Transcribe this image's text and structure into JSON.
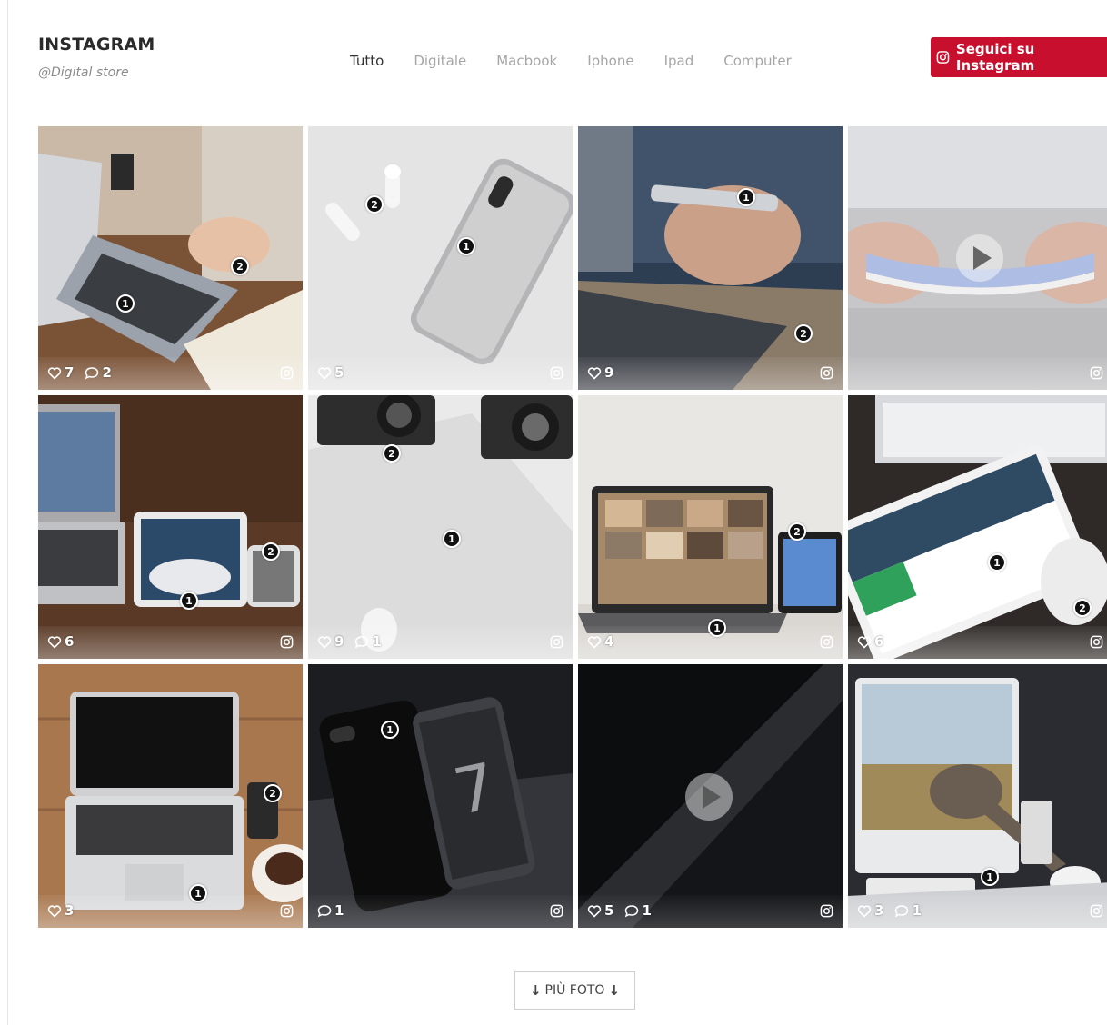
{
  "header": {
    "title": "INSTAGRAM",
    "subtitle": "@Digital store"
  },
  "filters": [
    {
      "label": "Tutto",
      "active": true
    },
    {
      "label": "Digitale",
      "active": false
    },
    {
      "label": "Macbook",
      "active": false
    },
    {
      "label": "Iphone",
      "active": false
    },
    {
      "label": "Ipad",
      "active": false
    },
    {
      "label": "Computer",
      "active": false
    }
  ],
  "follow_button": {
    "label": "Seguici su Instagram",
    "icon": "instagram-icon",
    "color": "#c8102e"
  },
  "tiles": [
    {
      "likes": "7",
      "comments": "2",
      "video": false
    },
    {
      "likes": "5",
      "comments": "",
      "video": false
    },
    {
      "likes": "9",
      "comments": "",
      "video": false
    },
    {
      "likes": "",
      "comments": "",
      "video": true
    },
    {
      "likes": "6",
      "comments": "",
      "video": false
    },
    {
      "likes": "9",
      "comments": "1",
      "video": false
    },
    {
      "likes": "4",
      "comments": "",
      "video": false
    },
    {
      "likes": "6",
      "comments": "",
      "video": false
    },
    {
      "likes": "3",
      "comments": "",
      "video": false
    },
    {
      "likes": "",
      "comments": "1",
      "video": false
    },
    {
      "likes": "5",
      "comments": "1",
      "video": true
    },
    {
      "likes": "3",
      "comments": "1",
      "video": false
    }
  ],
  "markers": {
    "one": "1",
    "two": "2"
  },
  "more_button": {
    "label": "PIÙ FOTO",
    "arrow": "↓"
  }
}
